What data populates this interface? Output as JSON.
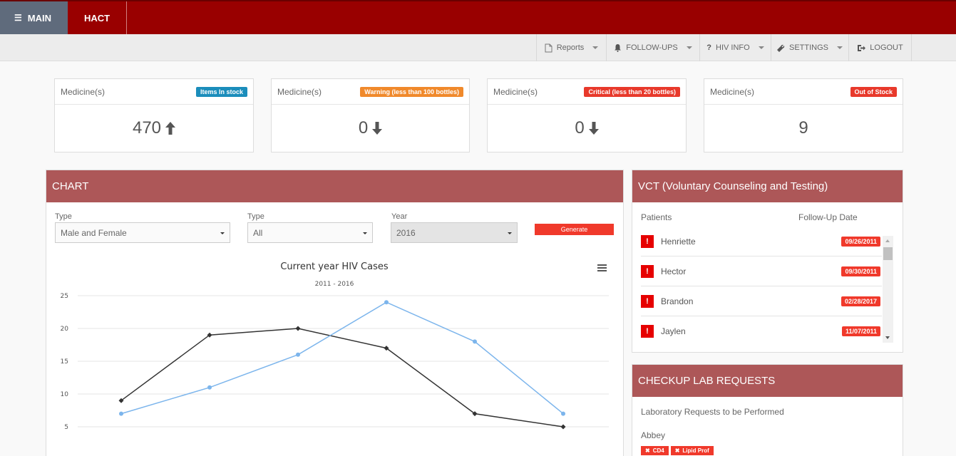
{
  "topnav": {
    "main_label": "MAIN",
    "hact_label": "HACT"
  },
  "submenu": [
    {
      "label": "Reports",
      "icon": "document-icon"
    },
    {
      "label": "FOLLOW-UPS",
      "icon": "bell-icon"
    },
    {
      "label": "HIV INFO",
      "icon": "question-icon"
    },
    {
      "label": "SETTINGS",
      "icon": "wrench-icon"
    },
    {
      "label": "LOGOUT",
      "icon": "logout-icon"
    }
  ],
  "stats": [
    {
      "title": "Medicine(s)",
      "badge": "Items In stock",
      "badge_color": "#1b8dbb",
      "value": "470",
      "trend": "up"
    },
    {
      "title": "Medicine(s)",
      "badge": "Warning (less than 100 bottles)",
      "badge_color": "#f0892b",
      "value": "0",
      "trend": "down"
    },
    {
      "title": "Medicine(s)",
      "badge": "Critical (less than 20 bottles)",
      "badge_color": "#e8392b",
      "value": "0",
      "trend": "down"
    },
    {
      "title": "Medicine(s)",
      "badge": "Out of Stock",
      "badge_color": "#e8392b",
      "value": "9",
      "trend": "none"
    }
  ],
  "chart_panel": {
    "title": "CHART",
    "filters": [
      {
        "label": "Type",
        "value": "Male and Female"
      },
      {
        "label": "Type",
        "value": "All"
      },
      {
        "label": "Year",
        "value": "2016"
      }
    ],
    "generate_label": "Generate"
  },
  "chart_data": {
    "type": "line",
    "title": "Current year HIV Cases",
    "subtitle": "2011 - 2016",
    "x": [
      1,
      2,
      3,
      4,
      5,
      6
    ],
    "ylim": [
      0,
      25
    ],
    "yticks": [
      5,
      10,
      15,
      20,
      25
    ],
    "grid": true,
    "series": [
      {
        "color": "#333333",
        "values": [
          9,
          19,
          20,
          17,
          7,
          5
        ]
      },
      {
        "color": "#7cb5ec",
        "values": [
          7,
          11,
          16,
          24,
          18,
          7
        ]
      }
    ]
  },
  "vct": {
    "title": "VCT (Voluntary Counseling and Testing)",
    "col_patients": "Patients",
    "col_date": "Follow-Up Date",
    "rows": [
      {
        "name": "Henriette",
        "date": "09/26/2011"
      },
      {
        "name": "Hector",
        "date": "09/30/2011"
      },
      {
        "name": "Brandon",
        "date": "02/28/2017"
      },
      {
        "name": "Jaylen",
        "date": "11/07/2011"
      }
    ]
  },
  "lab": {
    "title": "CHECKUP LAB REQUESTS",
    "subtitle": "Laboratory Requests to be Performed",
    "patient": "Abbey",
    "tags": [
      "CD4",
      "Lipid Prof"
    ]
  }
}
